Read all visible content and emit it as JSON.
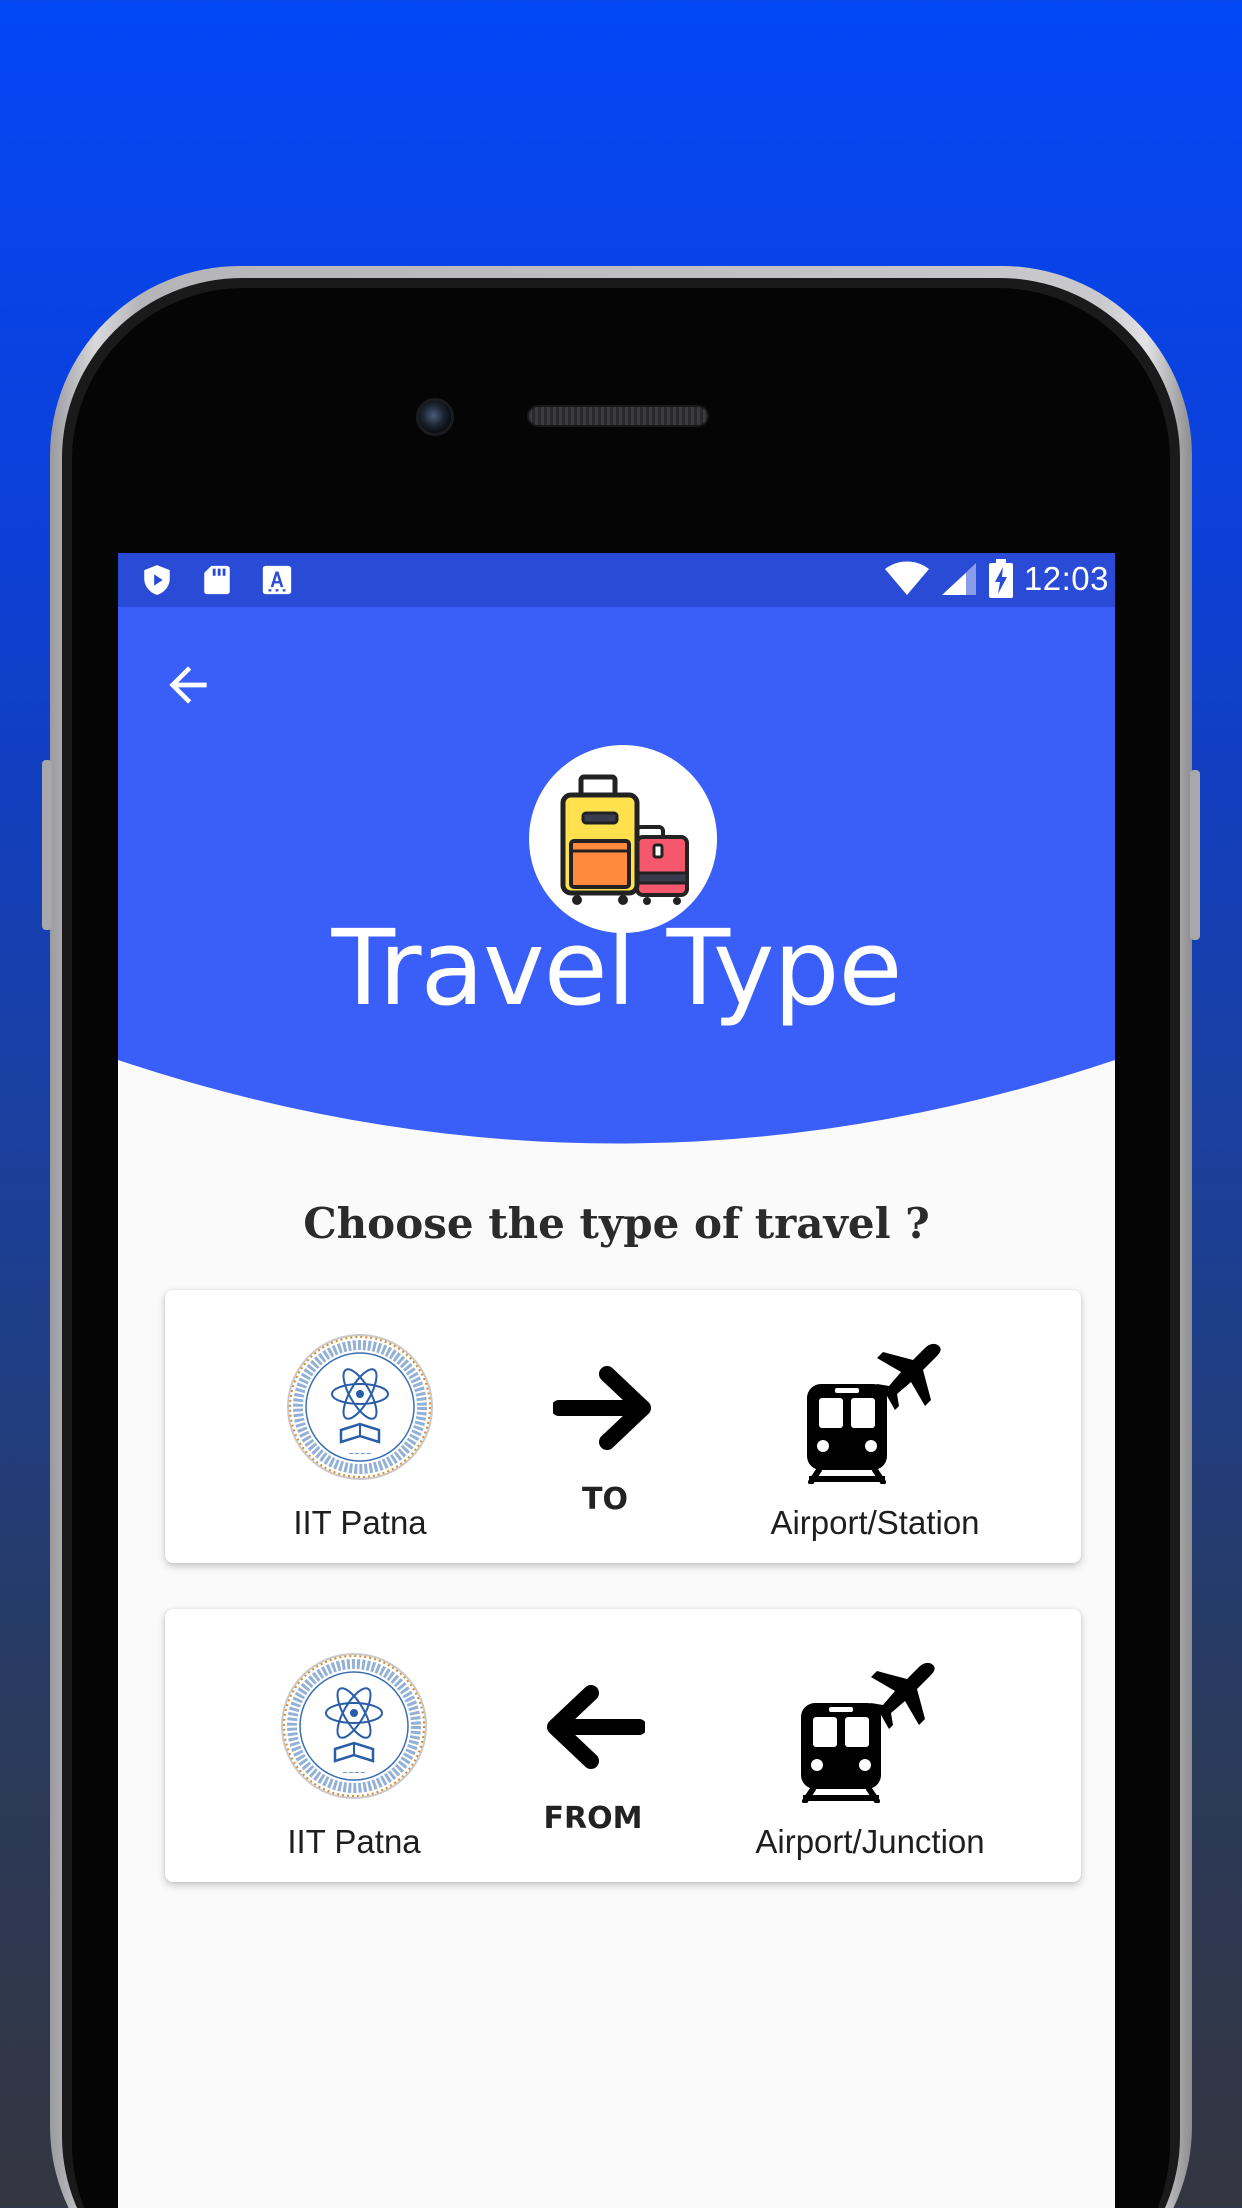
{
  "status_bar": {
    "time": "12:03",
    "left_icons": [
      "shield-play-icon",
      "sd-card-icon",
      "text-a-icon"
    ],
    "right_icons": [
      "wifi-icon",
      "signal-icon",
      "battery-charging-icon"
    ]
  },
  "header": {
    "title": "Travel Type",
    "background": "#3a5ef8",
    "logo_icon": "luggage-icon"
  },
  "question": "Choose the type of travel ?",
  "options": [
    {
      "from_label": "IIT Patna",
      "direction_label": "TO",
      "direction_icon": "arrow-right-icon",
      "to_label": "Airport/Station"
    },
    {
      "from_label": "IIT Patna",
      "direction_label": "FROM",
      "direction_icon": "arrow-left-icon",
      "to_label": "Airport/Junction"
    }
  ],
  "colors": {
    "status_bar": "#2a4bd6",
    "header": "#3a5ef8",
    "screen_bg": "#fafafa"
  }
}
